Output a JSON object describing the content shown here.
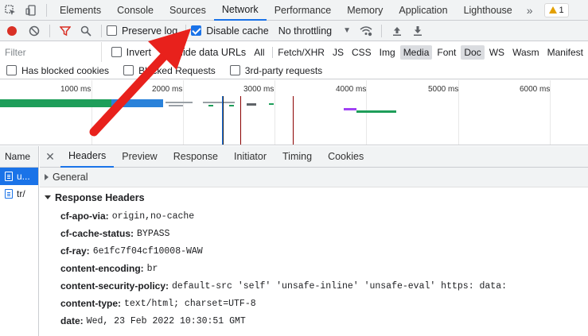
{
  "tabs": [
    "Elements",
    "Console",
    "Sources",
    "Network",
    "Performance",
    "Memory",
    "Application",
    "Lighthouse"
  ],
  "active_tab": "Network",
  "more_tabs": "»",
  "warning_count": "1",
  "toolbar": {
    "preserve_log": "Preserve log",
    "disable_cache": "Disable cache",
    "throttling": "No throttling"
  },
  "filter": {
    "placeholder": "Filter",
    "invert": "Invert",
    "hide_data_urls": "Hide data URLs",
    "types": [
      "All",
      "Fetch/XHR",
      "JS",
      "CSS",
      "Img",
      "Media",
      "Font",
      "Doc",
      "WS",
      "Wasm",
      "Manifest"
    ],
    "selected_types": [
      "Media",
      "Doc"
    ],
    "has_blocked_cookies": "Has blocked cookies",
    "blocked_requests": "Blocked Requests",
    "third_party": "3rd-party requests"
  },
  "overview": {
    "ticks": [
      "1000 ms",
      "2000 ms",
      "3000 ms",
      "4000 ms",
      "5000 ms",
      "6000 ms"
    ]
  },
  "requests": {
    "header": "Name",
    "rows": [
      "u...",
      "tr/"
    ]
  },
  "detail": {
    "tabs": [
      "Headers",
      "Preview",
      "Response",
      "Initiator",
      "Timing",
      "Cookies"
    ],
    "active_tab": "Headers",
    "general": "General",
    "response_headers_title": "Response Headers",
    "headers": [
      {
        "name": "cf-apo-via:",
        "value": "origin,no-cache"
      },
      {
        "name": "cf-cache-status:",
        "value": "BYPASS"
      },
      {
        "name": "cf-ray:",
        "value": "6e1fc7f04cf10008-WAW"
      },
      {
        "name": "content-encoding:",
        "value": "br"
      },
      {
        "name": "content-security-policy:",
        "value": "default-src 'self' 'unsafe-inline' 'unsafe-eval' https: data:"
      },
      {
        "name": "content-type:",
        "value": "text/html; charset=UTF-8"
      },
      {
        "name": "date:",
        "value": "Wed, 23 Feb 2022 10:30:51 GMT"
      }
    ]
  },
  "colors": {
    "accent": "#1a73e8",
    "record": "#d93025",
    "annotation_arrow": "#e8211c"
  }
}
